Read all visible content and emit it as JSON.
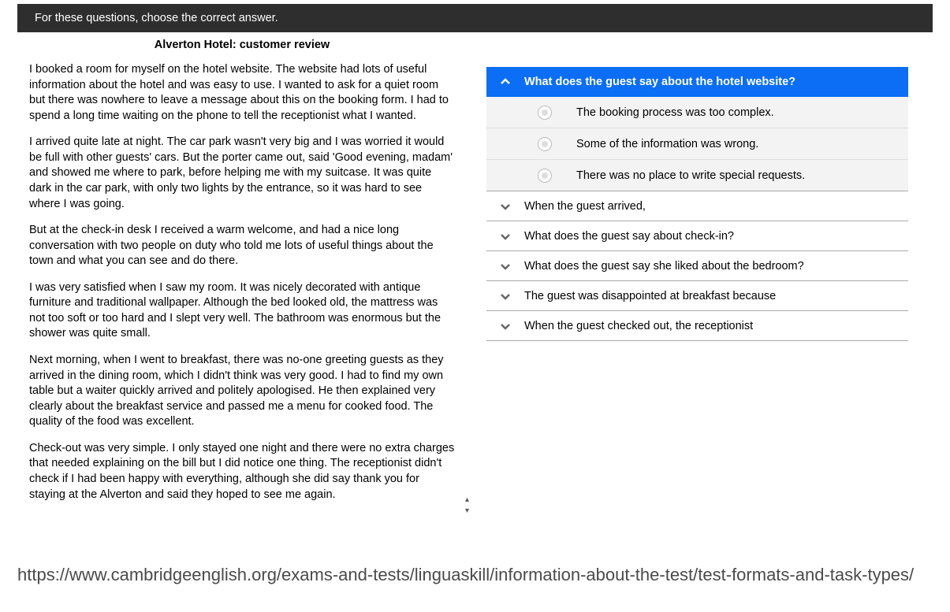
{
  "topInstruction": "For these questions, choose the correct answer.",
  "passage": {
    "title": "Alverton Hotel: customer review",
    "paragraphs": [
      "I booked a room for myself on the hotel website. The website had lots of useful information about the hotel and was easy to use.  I wanted to ask for a quiet room but there was nowhere to leave a message about this on the booking form.  I had to spend a long time waiting on the phone to tell the receptionist what I wanted.",
      "I arrived quite late at night.  The car park wasn't very big and I was worried it would be full with other guests' cars.  But the porter came out, said 'Good evening, madam' and showed me where to park, before helping me with my suitcase.  It was quite dark in the car park, with only two lights by the entrance, so it was hard to see where I was going.",
      "But at the check-in desk I received a warm welcome, and had a nice long conversation with two people on duty who told me lots of useful things about the town and what you can see and do there.",
      "I was very satisfied when I saw my room.  It was nicely decorated with antique furniture and traditional wallpaper.  Although the bed looked old, the mattress was not too soft or too hard and I slept very well.  The bathroom was enormous but the shower was quite small.",
      "Next morning, when I went to breakfast, there was no-one greeting guests as they arrived in the dining room, which I didn't think was very good.  I had to find my own table but a waiter quickly arrived and politely apologised.  He then explained very clearly about the breakfast service and passed me a menu for cooked food.  The quality of the food was excellent.",
      "Check-out was very simple.  I only stayed one night and there were no extra charges that needed explaining on the bill but I did notice one thing.  The receptionist didn't check if I had been happy with everything, although she did say thank you for staying at the Alverton and said they hoped to see me again."
    ]
  },
  "questions": [
    {
      "text": "What does the guest say about the hotel website?",
      "expanded": true,
      "options": [
        "The booking process was too complex.",
        "Some of the information was wrong.",
        "There was no place to write special requests."
      ]
    },
    {
      "text": "When the guest arrived,",
      "expanded": false
    },
    {
      "text": "What does the guest say about check-in?",
      "expanded": false
    },
    {
      "text": "What does the guest say she liked about the bedroom?",
      "expanded": false
    },
    {
      "text": "The guest was disappointed at breakfast because",
      "expanded": false
    },
    {
      "text": "When the guest checked out, the receptionist",
      "expanded": false
    }
  ],
  "bottomUrl": "https://www.cambridgeenglish.org/exams-and-tests/linguaskill/information-about-the-test/test-formats-and-task-types/"
}
